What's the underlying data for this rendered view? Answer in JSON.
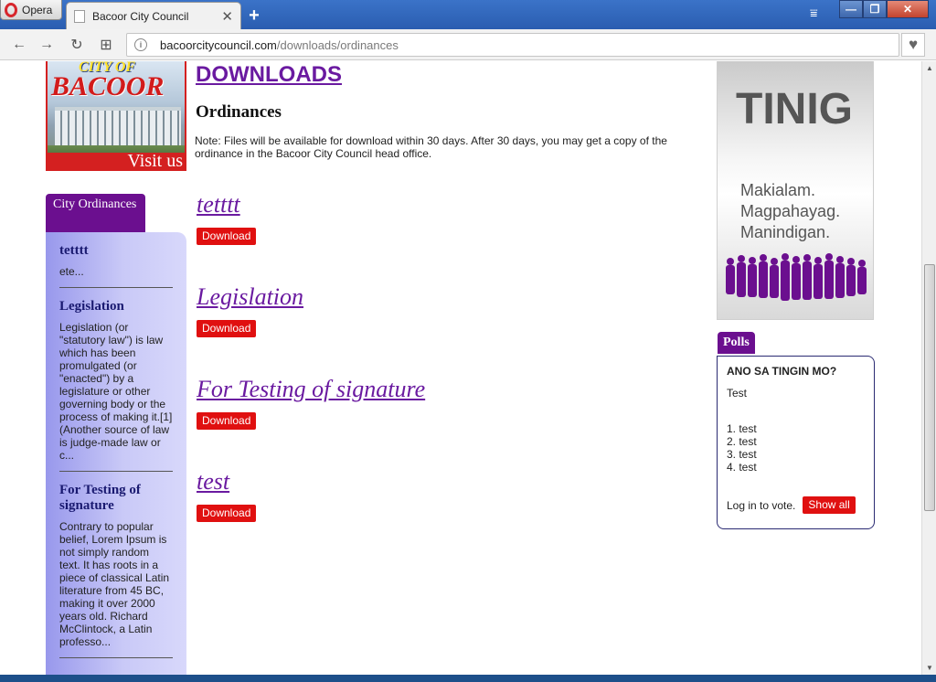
{
  "browser": {
    "opera_label": "Opera",
    "tab_title": "Bacoor City Council",
    "url_host": "bacoorcitycouncil.com",
    "url_path": "/downloads/ordinances",
    "nav_back": "←",
    "nav_forward": "→",
    "nav_reload": "↻",
    "nav_apps": "⊞",
    "new_tab": "+",
    "menu": "⩸",
    "win_min": "—",
    "win_max": "❐",
    "win_close": "✕",
    "tab_close": "✕",
    "heart": "♥",
    "site_info": "i"
  },
  "logo": {
    "city_of": "CITY OF",
    "bacoor": "BACOOR",
    "visit": "Visit us"
  },
  "main": {
    "heading": "DOWNLOADS",
    "subheading": "Ordinances",
    "note": "Note: Files will be available for download within 30 days. After 30 days, you may get a copy of the ordinance in the Bacoor City Council head office.",
    "download_label": "Download",
    "documents": [
      {
        "title": "tetttt"
      },
      {
        "title": "Legislation"
      },
      {
        "title": "For Testing of signature"
      },
      {
        "title": "test"
      }
    ]
  },
  "sidebar": {
    "tab_label": "City Ordinances",
    "items": [
      {
        "title": "tetttt",
        "body": "ete..."
      },
      {
        "title": "Legislation",
        "body": "Legislation (or \"statutory law\") is law which has been promulgated (or \"enacted\") by a legislature or other governing body or the process of making it.[1] (Another source of law is judge-made law or c..."
      },
      {
        "title": "For Testing of signature",
        "body": "Contrary to popular belief, Lorem Ipsum is not simply random text. It has roots in a piece of classical Latin literature from 45 BC, making it over 2000 years old. Richard McClintock, a Latin professo..."
      }
    ]
  },
  "ad": {
    "title": "TINIG",
    "slogans": [
      "Makialam.",
      "Magpahayag.",
      "Manindigan."
    ]
  },
  "polls": {
    "tab_label": "Polls",
    "question": "ANO SA TINGIN MO?",
    "description": "Test",
    "options": [
      "1. test",
      "2. test",
      "3. test",
      "4. test"
    ],
    "login_text": "Log in to vote.",
    "show_all": "Show all"
  },
  "colors": {
    "brand_purple": "#6b0f8f",
    "link_purple": "#6a1aa0",
    "button_red": "#e01010"
  }
}
